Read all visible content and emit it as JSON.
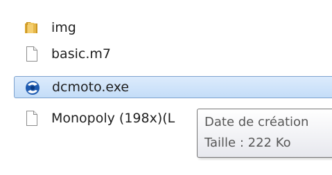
{
  "files": [
    {
      "name": "img",
      "icon": "folder-icon"
    },
    {
      "name": "basic.m7",
      "icon": "document-icon"
    },
    {
      "name": "dcmoto.exe",
      "icon": "application-icon",
      "selected": true
    },
    {
      "name": "Monopoly (198x)(L",
      "icon": "document-icon"
    }
  ],
  "tooltip": {
    "line1": "Date de création",
    "line2": "Taille : 222 Ko"
  },
  "colors": {
    "selection_background": "#cce0f8",
    "selection_border": "#7da2ce",
    "folder": "#e8b84a",
    "tooltip_text": "#575757"
  }
}
